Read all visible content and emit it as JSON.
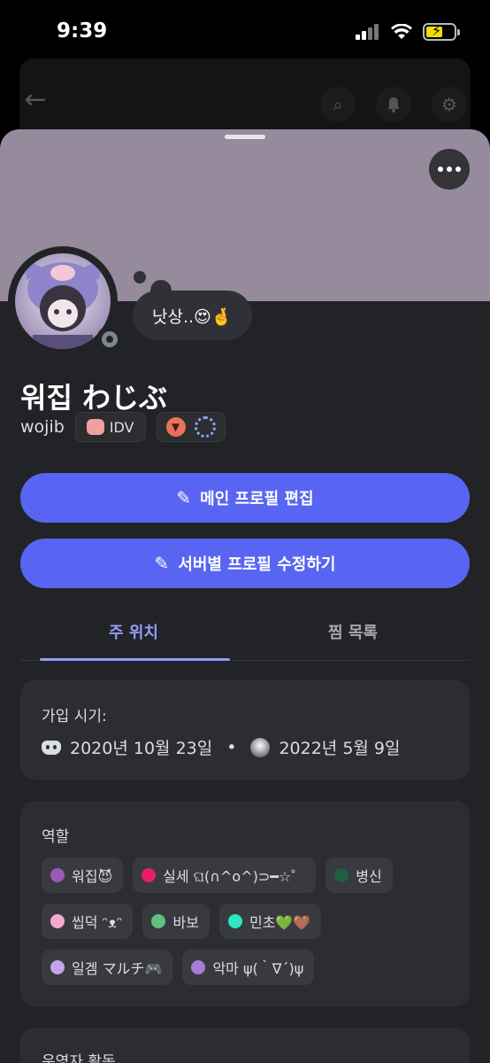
{
  "status_bar": {
    "time": "9:39"
  },
  "profile": {
    "display_name": "워집 わじぶ",
    "username": "wojib",
    "tag_label": "IDV",
    "custom_status": "낫상..😍🤞",
    "banner_color": "#968a9d"
  },
  "buttons": {
    "edit_main_profile": "메인 프로필 편집",
    "edit_server_profile": "서버별 프로필 수정하기"
  },
  "tabs": [
    {
      "label": "주 위치",
      "active": true
    },
    {
      "label": "찜 목록",
      "active": false
    }
  ],
  "joined": {
    "title": "가입 시기:",
    "discord_date": "2020년 10월 23일",
    "separator": "•",
    "server_date": "2022년 5월 9일"
  },
  "roles_card": {
    "title": "역할",
    "roles": [
      {
        "name": "워집😈",
        "color": "#9b59b6"
      },
      {
        "name": "실세 ଘ(∩^o^)⊃━☆゜",
        "color": "#e91e63"
      },
      {
        "name": "병신",
        "color": "#1f5f3f"
      },
      {
        "name": "씹덕 ᵔᴥᵔ",
        "color": "#f9a8d4"
      },
      {
        "name": "바보",
        "color": "#5fbf7f"
      },
      {
        "name": "민초💚🤎",
        "color": "#2ee6c4"
      },
      {
        "name": "일겜 マルチ🎮",
        "color": "#c5a3e8"
      },
      {
        "name": "악마 ψ(｀∇´)ψ",
        "color": "#a57dd6"
      }
    ]
  },
  "next_card": {
    "title": "운영자 활동"
  }
}
